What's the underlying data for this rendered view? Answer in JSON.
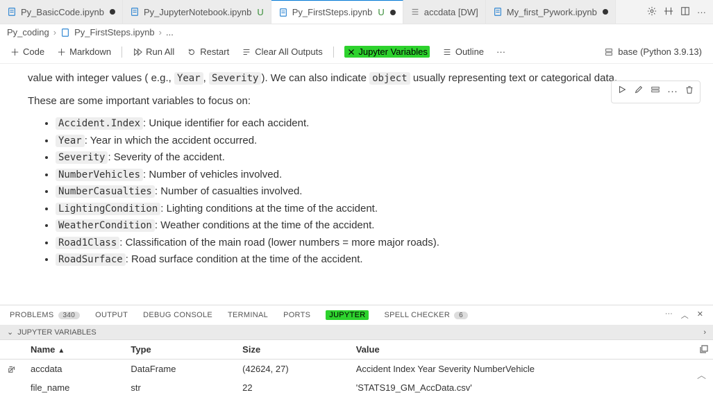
{
  "tabs": [
    {
      "name": "Py_BasicCode.ipynb",
      "mod": "",
      "dirty": true
    },
    {
      "name": "Py_JupyterNotebook.ipynb",
      "mod": "U",
      "dirty": false
    },
    {
      "name": "Py_FirstSteps.ipynb",
      "mod": "U",
      "dirty": true,
      "active": true
    },
    {
      "name": "accdata [DW]",
      "mod": "",
      "dirty": false,
      "plain": true
    },
    {
      "name": "My_first_Pywork.ipynb",
      "mod": "",
      "dirty": true
    }
  ],
  "breadcrumb": [
    "Py_coding",
    "Py_FirstSteps.ipynb",
    "..."
  ],
  "toolbar": {
    "code": "Code",
    "markdown": "Markdown",
    "runall": "Run All",
    "restart": "Restart",
    "clear": "Clear All Outputs",
    "vars": "Jupyter Variables",
    "outline": "Outline",
    "kernel": "base (Python 3.9.13)"
  },
  "body": {
    "topline_pre": "value with integer values ( e.g., ",
    "topline_code1": "Year",
    "topline_mid": ", ",
    "topline_code2": "Severity",
    "topline_mid2": "). We can also indicate ",
    "topline_code3": "object",
    "topline_post": " usually representing text or categorical data.",
    "intro": "These are some important variables to focus on:",
    "items": [
      {
        "k": "Accident.Index",
        "v": ": Unique identifier for each accident."
      },
      {
        "k": "Year",
        "v": ": Year in which the accident occurred."
      },
      {
        "k": "Severity",
        "v": ": Severity of the accident."
      },
      {
        "k": "NumberVehicles",
        "v": ": Number of vehicles involved."
      },
      {
        "k": "NumberCasualties",
        "v": ": Number of casualties involved."
      },
      {
        "k": "LightingCondition",
        "v": ": Lighting conditions at the time of the accident."
      },
      {
        "k": "WeatherCondition",
        "v": ": Weather conditions at the time of the accident."
      },
      {
        "k": "Road1Class",
        "v": ": Classification of the main road (lower numbers = more major roads)."
      },
      {
        "k": "RoadSurface",
        "v": ": Road surface condition at the time of the accident."
      }
    ]
  },
  "panel": {
    "tabs": {
      "problems": "PROBLEMS",
      "problems_n": "340",
      "output": "OUTPUT",
      "debug": "DEBUG CONSOLE",
      "terminal": "TERMINAL",
      "ports": "PORTS",
      "jupyter": "JUPYTER",
      "spell": "SPELL CHECKER",
      "spell_n": "6"
    },
    "section": "JUPYTER VARIABLES",
    "cols": {
      "name": "Name",
      "type": "Type",
      "size": "Size",
      "value": "Value"
    },
    "rows": [
      {
        "name": "accdata",
        "type": "DataFrame",
        "size": "(42624, 27)",
        "value": "Accident Index  Year  Severity  NumberVehicle"
      },
      {
        "name": "file_name",
        "type": "str",
        "size": "22",
        "value": "'STATS19_GM_AccData.csv'"
      }
    ]
  }
}
